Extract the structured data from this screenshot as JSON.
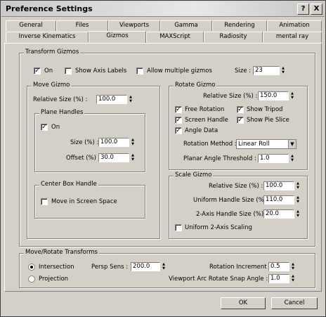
{
  "window": {
    "title": "Preference Settings",
    "help_label": "?",
    "close_label": "X"
  },
  "tabs_row1": [
    "General",
    "Files",
    "Viewports",
    "Gamma",
    "Rendering",
    "Animation"
  ],
  "tabs_row2": [
    "Inverse Kinematics",
    "Gizmos",
    "MAXScript",
    "Radiosity",
    "mental ray"
  ],
  "active_tab": "Gizmos",
  "transform_gizmos": {
    "title": "Transform Gizmos",
    "on_label": "On",
    "on_checked": "✓",
    "show_axis_labels_label": "Show Axis Labels",
    "allow_multiple_label": "Allow multiple gizmos",
    "size_label": "Size :",
    "size_value": "23"
  },
  "move_gizmo": {
    "title": "Move Gizmo",
    "relative_size_label": "Relative Size (%) :",
    "relative_size_value": "100.0",
    "plane_handles": {
      "title": "Plane Handles",
      "on_label": "On",
      "on_checked": "✓",
      "size_label": "Size (%) :",
      "size_value": "100.0",
      "offset_label": "Offset (%) :",
      "offset_value": "30.0"
    },
    "center_box": {
      "title": "Center Box Handle",
      "move_screen_label": "Move in Screen Space"
    }
  },
  "rotate_gizmo": {
    "title": "Rotate Gizmo",
    "relative_size_label": "Relative Size (%) :",
    "relative_size_value": "150.0",
    "free_rotation_label": "Free Rotation",
    "show_tripod_label": "Show Tripod",
    "screen_handle_label": "Screen Handle",
    "show_pie_slice_label": "Show Pie Slice",
    "angle_data_label": "Angle Data",
    "check_mark": "✓",
    "rotation_method_label": "Rotation Method :",
    "rotation_method_value": "Linear Roll",
    "planar_threshold_label": "Planar Angle Threshold :",
    "planar_threshold_value": "1.0"
  },
  "scale_gizmo": {
    "title": "Scale Gizmo",
    "relative_size_label": "Relative Size (%) :",
    "relative_size_value": "100.0",
    "uniform_handle_label": "Uniform Handle Size (%) :",
    "uniform_handle_value": "110.0",
    "two_axis_label": "2-Axis Handle Size (%) :",
    "two_axis_value": "20.0",
    "uniform_scaling_label": "Uniform 2-Axis Scaling"
  },
  "move_rotate": {
    "title": "Move/Rotate Transforms",
    "intersection_label": "Intersection",
    "projection_label": "Projection",
    "persp_sens_label": "Persp Sens :",
    "persp_sens_value": "200.0",
    "rotation_increment_label": "Rotation Increment :",
    "rotation_increment_value": "0.5",
    "viewport_arc_label": "Viewport Arc Rotate Snap Angle :",
    "viewport_arc_value": "1.0"
  },
  "buttons": {
    "ok": "OK",
    "cancel": "Cancel"
  },
  "spinner_arrows": {
    "up": "▲",
    "down": "▼"
  },
  "dropdown_arrow": "▼"
}
